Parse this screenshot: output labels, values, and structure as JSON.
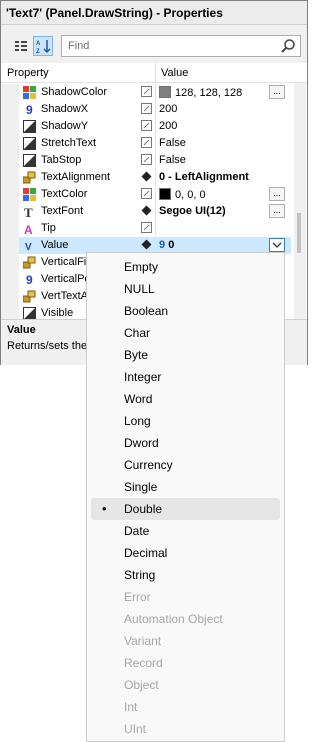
{
  "window": {
    "title": "'Text7' (Panel.DrawString) - Properties"
  },
  "toolbar": {
    "find_placeholder": "Find",
    "categorized_icon": "categorized-icon",
    "alpha_icon": "alphabetical-sort-icon",
    "search_icon": "search-icon"
  },
  "grid": {
    "header_property": "Property",
    "header_value": "Value",
    "rows": [
      {
        "name": "ShadowColor",
        "icon": "color-icon",
        "value": "128, 128, 128",
        "swatch": "#808080",
        "ellipsis": "..."
      },
      {
        "name": "ShadowX",
        "icon": "number-icon",
        "value": "200"
      },
      {
        "name": "ShadowY",
        "icon": "bool-icon",
        "value": "200"
      },
      {
        "name": "StretchText",
        "icon": "bool-icon",
        "value": "False"
      },
      {
        "name": "TabStop",
        "icon": "bool-icon",
        "value": "False"
      },
      {
        "name": "TextAlignment",
        "icon": "enum-icon",
        "value": "0 - LeftAlignment",
        "bold": true
      },
      {
        "name": "TextColor",
        "icon": "color-icon",
        "value": "0, 0, 0",
        "swatch": "#000000",
        "ellipsis": "..."
      },
      {
        "name": "TextFont",
        "icon": "font-icon",
        "value": "Segoe UI(12)",
        "bold": true,
        "ellipsis": "..."
      },
      {
        "name": "Tip",
        "icon": "tip-icon",
        "value": ""
      },
      {
        "name": "Value",
        "icon": "variant-icon",
        "value": "0",
        "selected": true,
        "value_icon": "9"
      },
      {
        "name": "VerticalFil",
        "icon": "enum-icon",
        "value": ""
      },
      {
        "name": "VerticalPe",
        "icon": "number-icon",
        "value": ""
      },
      {
        "name": "VertTextA",
        "icon": "enum-icon",
        "value": ""
      },
      {
        "name": "Visible",
        "icon": "bool-icon",
        "value": ""
      }
    ]
  },
  "icon_glyphs": {
    "number": "9",
    "font": "T",
    "tip": "A",
    "variant": "V"
  },
  "description": {
    "title": "Value",
    "text": "Returns/sets the"
  },
  "dropdown": {
    "selected": "Double",
    "options": [
      {
        "label": "Empty",
        "enabled": true
      },
      {
        "label": "NULL",
        "enabled": true
      },
      {
        "label": "Boolean",
        "enabled": true
      },
      {
        "label": "Char",
        "enabled": true
      },
      {
        "label": "Byte",
        "enabled": true
      },
      {
        "label": "Integer",
        "enabled": true
      },
      {
        "label": "Word",
        "enabled": true
      },
      {
        "label": "Long",
        "enabled": true
      },
      {
        "label": "Dword",
        "enabled": true
      },
      {
        "label": "Currency",
        "enabled": true
      },
      {
        "label": "Single",
        "enabled": true
      },
      {
        "label": "Double",
        "enabled": true
      },
      {
        "label": "Date",
        "enabled": true
      },
      {
        "label": "Decimal",
        "enabled": true
      },
      {
        "label": "String",
        "enabled": true
      },
      {
        "label": "Error",
        "enabled": false
      },
      {
        "label": "Automation Object",
        "enabled": false
      },
      {
        "label": "Variant",
        "enabled": false
      },
      {
        "label": "Record",
        "enabled": false
      },
      {
        "label": "Object",
        "enabled": false
      },
      {
        "label": "Int",
        "enabled": false
      },
      {
        "label": "UInt",
        "enabled": false
      }
    ]
  },
  "colors": {
    "selection": "#cce8ff",
    "accent": "#1e5aa8",
    "disabled_text": "#a6a6a6"
  }
}
